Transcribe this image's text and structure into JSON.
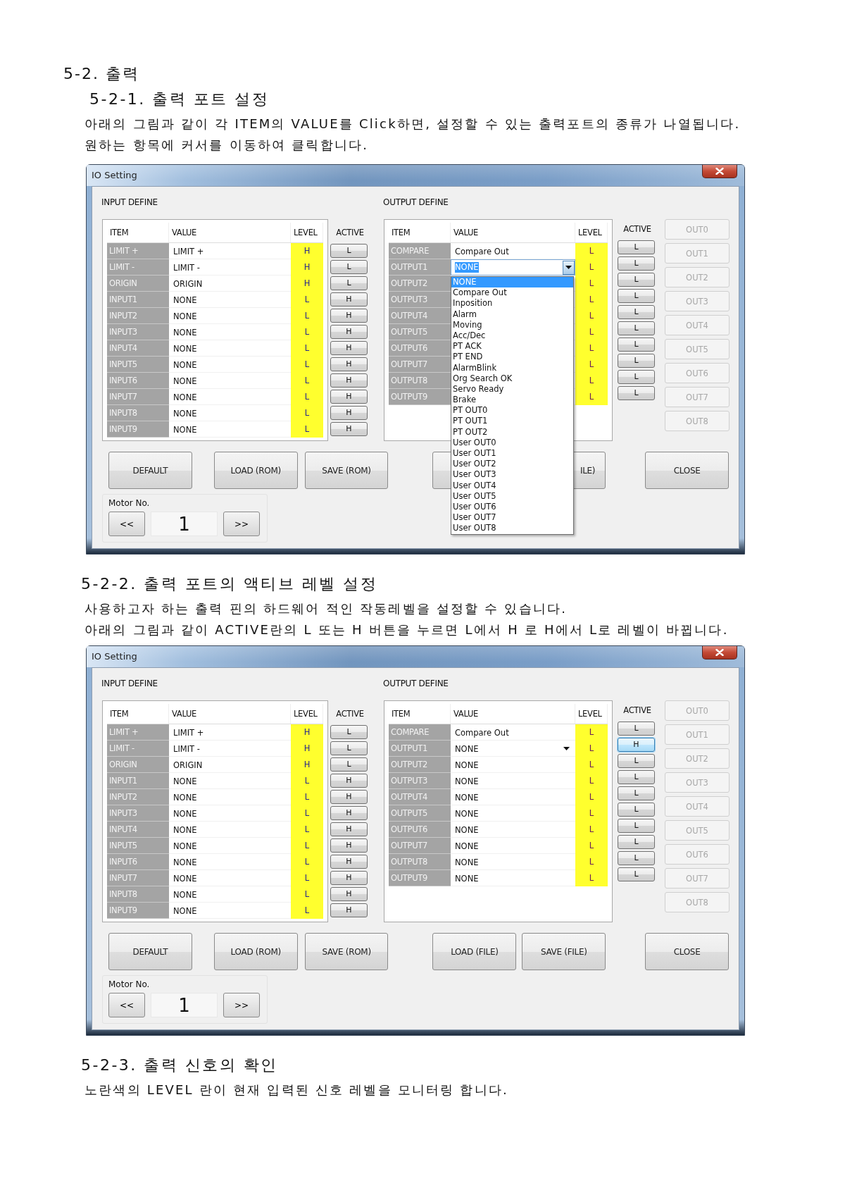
{
  "heading": "5-2. 출력",
  "sections": [
    {
      "title": "5-2-1. 출력 포트 설정",
      "paragraphs": [
        "아래의 그림과 같이 각 ITEM의 VALUE를 Click하면, 설정할 수 있는 출력포트의 종류가 나열됩니다.",
        "원하는 항목에 커서를 이동하여 클릭합니다."
      ],
      "window": {
        "title": "IO Setting",
        "input": {
          "label": "INPUT DEFINE",
          "columns": [
            "ITEM",
            "VALUE",
            "LEVEL"
          ],
          "active_label": "ACTIVE",
          "rows": [
            {
              "item": "LIMIT +",
              "value": "LIMIT +",
              "level": "H",
              "active": "L"
            },
            {
              "item": "LIMIT -",
              "value": "LIMIT -",
              "level": "H",
              "active": "L"
            },
            {
              "item": "ORIGIN",
              "value": "ORIGIN",
              "level": "H",
              "active": "L"
            },
            {
              "item": "INPUT1",
              "value": "NONE",
              "level": "L",
              "active": "H"
            },
            {
              "item": "INPUT2",
              "value": "NONE",
              "level": "L",
              "active": "H"
            },
            {
              "item": "INPUT3",
              "value": "NONE",
              "level": "L",
              "active": "H"
            },
            {
              "item": "INPUT4",
              "value": "NONE",
              "level": "L",
              "active": "H"
            },
            {
              "item": "INPUT5",
              "value": "NONE",
              "level": "L",
              "active": "H"
            },
            {
              "item": "INPUT6",
              "value": "NONE",
              "level": "L",
              "active": "H"
            },
            {
              "item": "INPUT7",
              "value": "NONE",
              "level": "L",
              "active": "H"
            },
            {
              "item": "INPUT8",
              "value": "NONE",
              "level": "L",
              "active": "H"
            },
            {
              "item": "INPUT9",
              "value": "NONE",
              "level": "L",
              "active": "H"
            }
          ]
        },
        "output": {
          "label": "OUTPUT DEFINE",
          "columns": [
            "ITEM",
            "VALUE",
            "LEVEL"
          ],
          "active_label": "ACTIVE",
          "rows": [
            {
              "item": "COMPARE",
              "kind": "text",
              "value": "Compare Out",
              "level": "L",
              "active": "L",
              "focused": false
            },
            {
              "item": "OUTPUT1",
              "kind": "combo",
              "value": "NONE",
              "open": true,
              "level": "L",
              "active": "L",
              "focused": false,
              "dropdown": {
                "options": [
                  {
                    "label": "NONE",
                    "selected": true
                  },
                  {
                    "label": "Compare Out",
                    "selected": false
                  },
                  {
                    "label": "Inposition",
                    "selected": false
                  },
                  {
                    "label": "Alarm",
                    "selected": false
                  },
                  {
                    "label": "Moving",
                    "selected": false
                  },
                  {
                    "label": "Acc/Dec",
                    "selected": false
                  },
                  {
                    "label": "PT ACK",
                    "selected": false
                  },
                  {
                    "label": "PT END",
                    "selected": false
                  },
                  {
                    "label": "AlarmBlink",
                    "selected": false
                  },
                  {
                    "label": "Org Search OK",
                    "selected": false
                  },
                  {
                    "label": "Servo Ready",
                    "selected": false
                  },
                  {
                    "label": "Brake",
                    "selected": false
                  },
                  {
                    "label": "PT OUT0",
                    "selected": false
                  },
                  {
                    "label": "PT OUT1",
                    "selected": false
                  },
                  {
                    "label": "PT OUT2",
                    "selected": false
                  },
                  {
                    "label": "User OUT0",
                    "selected": false
                  },
                  {
                    "label": "User OUT1",
                    "selected": false
                  },
                  {
                    "label": "User OUT2",
                    "selected": false
                  },
                  {
                    "label": "User OUT3",
                    "selected": false
                  },
                  {
                    "label": "User OUT4",
                    "selected": false
                  },
                  {
                    "label": "User OUT5",
                    "selected": false
                  },
                  {
                    "label": "User OUT6",
                    "selected": false
                  },
                  {
                    "label": "User OUT7",
                    "selected": false
                  },
                  {
                    "label": "User OUT8",
                    "selected": false
                  }
                ]
              }
            },
            {
              "item": "OUTPUT2",
              "kind": "text",
              "level": "L",
              "active": "L",
              "focused": false
            },
            {
              "item": "OUTPUT3",
              "kind": "text",
              "level": "L",
              "active": "L",
              "focused": false
            },
            {
              "item": "OUTPUT4",
              "kind": "text",
              "level": "L",
              "active": "L",
              "focused": false
            },
            {
              "item": "OUTPUT5",
              "kind": "text",
              "level": "L",
              "active": "L",
              "focused": false
            },
            {
              "item": "OUTPUT6",
              "kind": "text",
              "level": "L",
              "active": "L",
              "focused": false
            },
            {
              "item": "OUTPUT7",
              "kind": "text",
              "level": "L",
              "active": "L",
              "focused": false
            },
            {
              "item": "OUTPUT8",
              "kind": "text",
              "level": "L",
              "active": "L",
              "focused": false
            },
            {
              "item": "OUTPUT9",
              "kind": "text",
              "level": "L",
              "active": "L",
              "focused": false
            }
          ]
        },
        "out_buttons": [
          {
            "label": "OUT0",
            "disabled": true
          },
          {
            "label": "OUT1",
            "disabled": true
          },
          {
            "label": "OUT2",
            "disabled": true
          },
          {
            "label": "OUT3",
            "disabled": true
          },
          {
            "label": "OUT4",
            "disabled": true
          },
          {
            "label": "OUT5",
            "disabled": true
          },
          {
            "label": "OUT6",
            "disabled": true
          },
          {
            "label": "OUT7",
            "disabled": true
          },
          {
            "label": "OUT8",
            "disabled": true
          }
        ],
        "buttons": [
          {
            "kind": "labeled",
            "label": "DEFAULT"
          },
          {
            "kind": "labeled",
            "label": "LOAD (ROM)"
          },
          {
            "kind": "labeled",
            "label": "SAVE (ROM)"
          },
          {
            "kind": "covered"
          },
          {
            "kind": "partly_covered",
            "label": "ILE)"
          },
          {
            "kind": "labeled",
            "label": "CLOSE"
          }
        ],
        "motor": {
          "label": "Motor No.",
          "prev": "<<",
          "value": "1",
          "next": ">>"
        }
      }
    },
    {
      "title": "5-2-2. 출력 포트의 액티브 레벨 설정",
      "paragraphs": [
        "사용하고자 하는 출력 핀의 하드웨어 적인 작동레벨을 설정할 수 있습니다.",
        "아래의 그림과 같이 ACTIVE란의 L 또는 H 버튼을 누르면 L에서 H 로 H에서 L로 레벨이 바뀝니다."
      ],
      "window": {
        "title": "IO Setting",
        "input": {
          "label": "INPUT DEFINE",
          "columns": [
            "ITEM",
            "VALUE",
            "LEVEL"
          ],
          "active_label": "ACTIVE",
          "rows": [
            {
              "item": "LIMIT +",
              "value": "LIMIT +",
              "level": "H",
              "active": "L"
            },
            {
              "item": "LIMIT -",
              "value": "LIMIT -",
              "level": "H",
              "active": "L"
            },
            {
              "item": "ORIGIN",
              "value": "ORIGIN",
              "level": "H",
              "active": "L"
            },
            {
              "item": "INPUT1",
              "value": "NONE",
              "level": "L",
              "active": "H"
            },
            {
              "item": "INPUT2",
              "value": "NONE",
              "level": "L",
              "active": "H"
            },
            {
              "item": "INPUT3",
              "value": "NONE",
              "level": "L",
              "active": "H"
            },
            {
              "item": "INPUT4",
              "value": "NONE",
              "level": "L",
              "active": "H"
            },
            {
              "item": "INPUT5",
              "value": "NONE",
              "level": "L",
              "active": "H"
            },
            {
              "item": "INPUT6",
              "value": "NONE",
              "level": "L",
              "active": "H"
            },
            {
              "item": "INPUT7",
              "value": "NONE",
              "level": "L",
              "active": "H"
            },
            {
              "item": "INPUT8",
              "value": "NONE",
              "level": "L",
              "active": "H"
            },
            {
              "item": "INPUT9",
              "value": "NONE",
              "level": "L",
              "active": "H"
            }
          ]
        },
        "output": {
          "label": "OUTPUT DEFINE",
          "columns": [
            "ITEM",
            "VALUE",
            "LEVEL"
          ],
          "active_label": "ACTIVE",
          "rows": [
            {
              "item": "COMPARE",
              "kind": "text",
              "value": "Compare Out",
              "level": "L",
              "active": "L",
              "focused": false
            },
            {
              "item": "OUTPUT1",
              "kind": "combo",
              "value": "NONE",
              "open": false,
              "level": "L",
              "active": "H",
              "focused": true
            },
            {
              "item": "OUTPUT2",
              "kind": "text",
              "value": "NONE",
              "level": "L",
              "active": "L",
              "focused": false
            },
            {
              "item": "OUTPUT3",
              "kind": "text",
              "value": "NONE",
              "level": "L",
              "active": "L",
              "focused": false
            },
            {
              "item": "OUTPUT4",
              "kind": "text",
              "value": "NONE",
              "level": "L",
              "active": "L",
              "focused": false
            },
            {
              "item": "OUTPUT5",
              "kind": "text",
              "value": "NONE",
              "level": "L",
              "active": "L",
              "focused": false
            },
            {
              "item": "OUTPUT6",
              "kind": "text",
              "value": "NONE",
              "level": "L",
              "active": "L",
              "focused": false
            },
            {
              "item": "OUTPUT7",
              "kind": "text",
              "value": "NONE",
              "level": "L",
              "active": "L",
              "focused": false
            },
            {
              "item": "OUTPUT8",
              "kind": "text",
              "value": "NONE",
              "level": "L",
              "active": "L",
              "focused": false
            },
            {
              "item": "OUTPUT9",
              "kind": "text",
              "value": "NONE",
              "level": "L",
              "active": "L",
              "focused": false
            }
          ]
        },
        "out_buttons": [
          {
            "label": "OUT0",
            "disabled": true
          },
          {
            "label": "OUT1",
            "disabled": true
          },
          {
            "label": "OUT2",
            "disabled": true
          },
          {
            "label": "OUT3",
            "disabled": true
          },
          {
            "label": "OUT4",
            "disabled": true
          },
          {
            "label": "OUT5",
            "disabled": true
          },
          {
            "label": "OUT6",
            "disabled": true
          },
          {
            "label": "OUT7",
            "disabled": true
          },
          {
            "label": "OUT8",
            "disabled": true
          }
        ],
        "buttons": [
          {
            "kind": "labeled",
            "label": "DEFAULT"
          },
          {
            "kind": "labeled",
            "label": "LOAD (ROM)"
          },
          {
            "kind": "labeled",
            "label": "SAVE (ROM)"
          },
          {
            "kind": "labeled",
            "label": "LOAD (FILE)"
          },
          {
            "kind": "labeled",
            "label": "SAVE (FILE)"
          },
          {
            "kind": "labeled",
            "label": "CLOSE"
          }
        ],
        "motor": {
          "label": "Motor No.",
          "prev": "<<",
          "value": "1",
          "next": ">>"
        }
      }
    },
    {
      "title": "5-2-3. 출력 신호의 확인",
      "paragraphs": [
        "노란색의 LEVEL 란이 현재 입력된 신호 레벨을 모니터링 합니다."
      ]
    }
  ]
}
